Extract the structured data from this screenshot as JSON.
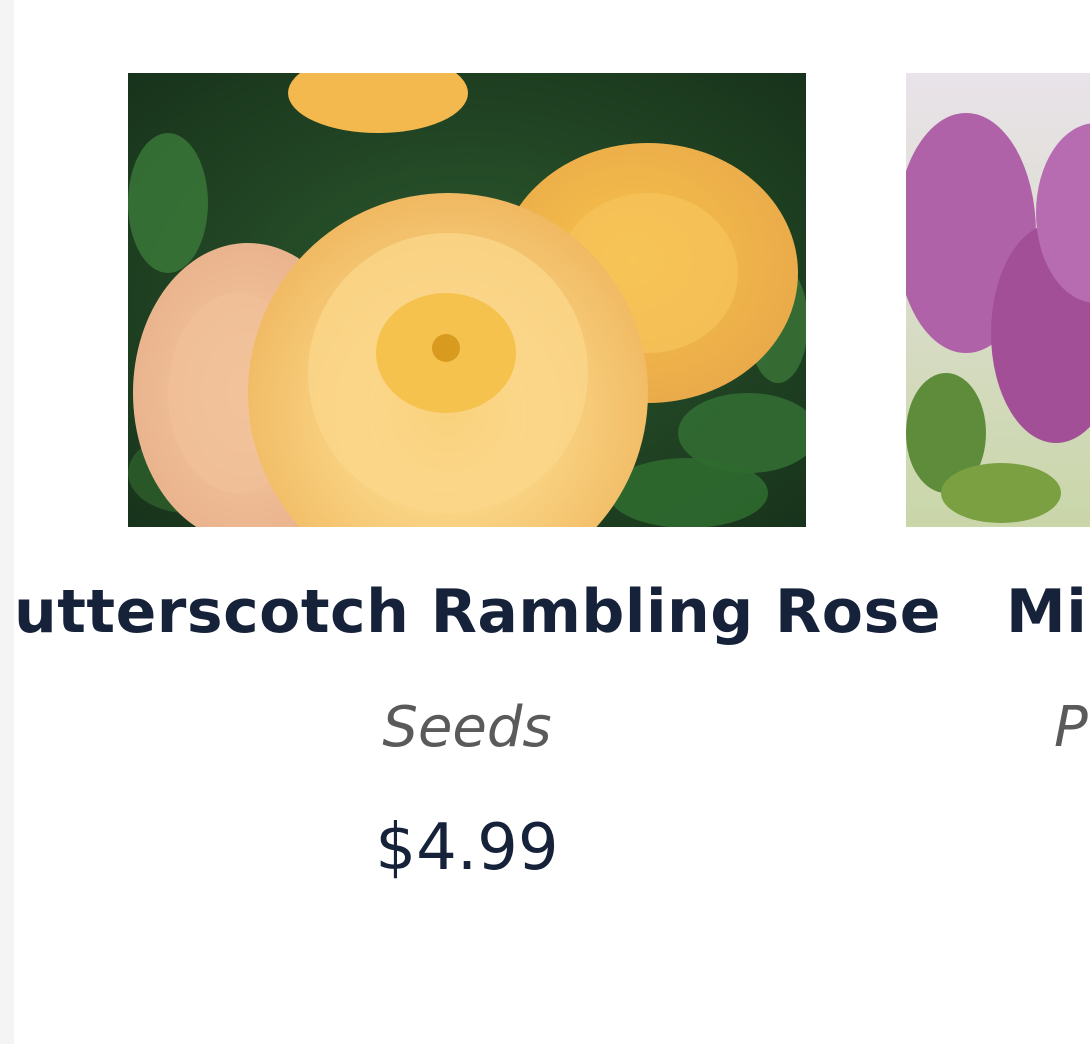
{
  "products": [
    {
      "name": "utterscotch Rambling Rose",
      "category": "Seeds",
      "price": "$4.99",
      "image": "yellow-rose-photo"
    },
    {
      "name": "Mis",
      "category": "P",
      "image": "purple-lilac-photo"
    }
  ],
  "colors": {
    "title": "#16213a",
    "category": "#5a5a5a",
    "gutter": "#f4f4f5"
  }
}
